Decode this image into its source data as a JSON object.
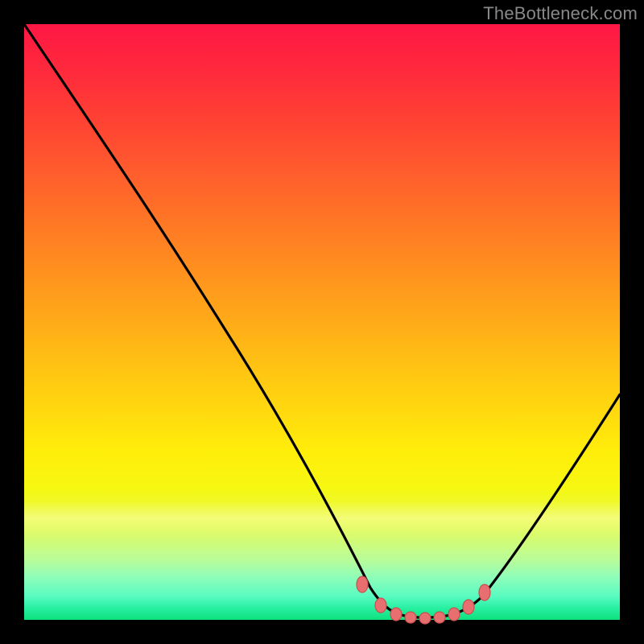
{
  "watermark": "TheBottleneck.com",
  "colors": {
    "frame": "#000000",
    "curve_stroke": "#000000",
    "marker_fill": "#e76f6f",
    "marker_stroke": "#c94f4f",
    "gradient_top": "#ff1744",
    "gradient_bottom": "#0ee07c"
  },
  "chart_data": {
    "type": "line",
    "title": "",
    "xlabel": "",
    "ylabel": "",
    "xlim": [
      0,
      100
    ],
    "ylim": [
      0,
      100
    ],
    "grid": false,
    "legend": false,
    "series": [
      {
        "name": "bottleneck-curve",
        "x": [
          0,
          5,
          10,
          15,
          20,
          25,
          30,
          35,
          40,
          45,
          50,
          55,
          57,
          60,
          63,
          66,
          69,
          72,
          75,
          78,
          82,
          86,
          90,
          94,
          98,
          100
        ],
        "y": [
          100,
          92,
          84,
          76,
          68,
          60,
          52,
          44,
          36,
          28,
          20,
          12,
          8,
          4,
          1.5,
          0.5,
          0.3,
          0.5,
          1.5,
          4,
          10,
          18,
          26,
          34,
          42,
          46
        ]
      }
    ],
    "markers": {
      "name": "optimal-zone-markers",
      "x": [
        57,
        60,
        62,
        64,
        66,
        68,
        70,
        72,
        75
      ],
      "y": [
        7,
        3.2,
        1.4,
        0.7,
        0.4,
        0.4,
        0.7,
        1.4,
        3.2
      ]
    }
  }
}
